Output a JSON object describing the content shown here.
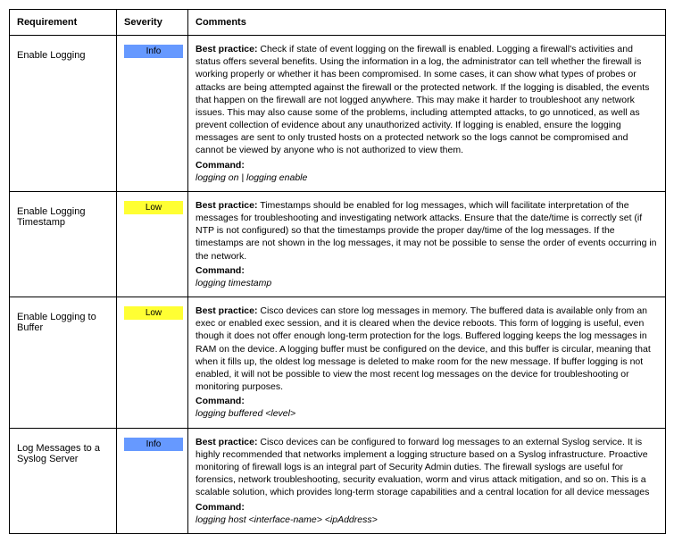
{
  "headers": {
    "requirement": "Requirement",
    "severity": "Severity",
    "comments": "Comments"
  },
  "labels": {
    "best_practice": "Best practice:",
    "command": "Command:"
  },
  "severity_colors": {
    "Info": "#6699ff",
    "Low": "#ffff33"
  },
  "rows": [
    {
      "requirement": "Enable Logging",
      "severity": "Info",
      "best_practice": "Check if state of event logging on the firewall is enabled. Logging a firewall's activities and status offers several benefits. Using the information in a log, the administrator can tell whether the firewall is working properly or whether it has been compromised. In some cases, it can show what types of probes or attacks are being attempted against the firewall or the protected network. If the logging is disabled, the events that happen on the firewall are not logged anywhere. This may make it harder to troubleshoot any network issues. This may also cause some of the problems, including attempted attacks, to go unnoticed, as well as prevent collection of evidence about any unauthorized activity. If logging is enabled, ensure the logging messages are sent to only trusted hosts on a protected network so the logs cannot be compromised and cannot be viewed by anyone who is not authorized to view them.",
      "command": "logging on | logging enable"
    },
    {
      "requirement": "Enable Logging Timestamp",
      "severity": "Low",
      "best_practice": "Timestamps should be enabled for log messages, which will facilitate interpretation of the messages for troubleshooting and investigating network attacks. Ensure that the date/time is correctly set (if NTP is not configured) so that the timestamps provide the proper day/time of the log messages. If the timestamps are not shown in the log messages, it may not be possible to sense the order of events occurring in the network.",
      "command": "logging timestamp"
    },
    {
      "requirement": "Enable Logging to Buffer",
      "severity": "Low",
      "best_practice": "Cisco devices can store log messages in memory. The buffered data is available only from an exec or enabled exec session, and it is cleared when the device reboots. This form of logging is useful, even though it does not offer enough long-term protection for the logs. Buffered logging keeps the log messages in RAM on the device. A logging buffer must be configured on the device, and this buffer is circular, meaning that when it fills up, the oldest log message is deleted to make room for the new message. If buffer logging is not enabled, it will not be possible to view the most recent log messages on the device for troubleshooting or monitoring purposes.",
      "command": "logging buffered <level>"
    },
    {
      "requirement": "Log Messages to a Syslog Server",
      "severity": "Info",
      "best_practice": "Cisco devices can be configured to forward log messages to an external Syslog service. It is highly recommended that networks implement a logging structure based on a Syslog infrastructure. Proactive monitoring of firewall logs is an integral part of Security Admin duties. The firewall syslogs are useful for forensics, network troubleshooting, security evaluation, worm and virus attack mitigation, and so on. This is a scalable solution, which provides long-term storage capabilities and a central location for all device messages",
      "command": "logging host <interface-name> <ipAddress>"
    }
  ]
}
